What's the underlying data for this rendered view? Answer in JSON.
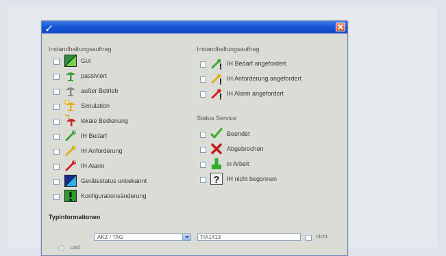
{
  "window": {
    "close_label": "×"
  },
  "left_section": {
    "title": "Instandhaltungsauftrag",
    "items": [
      {
        "label": "Gut",
        "icon": "status-good-icon"
      },
      {
        "label": "passiviert",
        "icon": "passivated-icon"
      },
      {
        "label": "außer Betrieb",
        "icon": "out-of-service-icon"
      },
      {
        "label": "Simulation",
        "icon": "simulation-icon"
      },
      {
        "label": "lokale Bedienung",
        "icon": "local-operation-icon"
      },
      {
        "label": "IH Bedarf",
        "icon": "wrench-green-icon"
      },
      {
        "label": "IH Anforderung",
        "icon": "wrench-yellow-icon"
      },
      {
        "label": "IH Alarm",
        "icon": "wrench-red-icon"
      },
      {
        "label": "Gerätestatus unbekannt",
        "icon": "status-unknown-icon"
      },
      {
        "label": "Konfigurationsänderung",
        "icon": "config-change-icon"
      }
    ]
  },
  "right_section_1": {
    "title": "Instandhaltungsauftrag",
    "items": [
      {
        "label": "IH Bedarf angefordert",
        "icon": "wrench-green-requested-icon"
      },
      {
        "label": "IH Anforderung angefordert",
        "icon": "wrench-yellow-requested-icon"
      },
      {
        "label": "IH Alarm angefordert",
        "icon": "wrench-red-requested-icon"
      }
    ]
  },
  "right_section_2": {
    "title": "Status Service",
    "items": [
      {
        "label": "Beendet",
        "icon": "checkmark-icon"
      },
      {
        "label": "Abgebrochen",
        "icon": "cancel-x-icon"
      },
      {
        "label": "in Arbeit",
        "icon": "in-progress-icon"
      },
      {
        "label": "IH nicht begonnen",
        "icon": "question-mark-icon"
      }
    ]
  },
  "type_info": {
    "title": "Typinformationen",
    "select_value": "AKZ / TAG",
    "text_value": "TIA1413",
    "nicht_label": "nicht",
    "und_label": "und"
  },
  "colors": {
    "titlebar": "#1957d8",
    "window_bg": "#dcdcd7"
  }
}
